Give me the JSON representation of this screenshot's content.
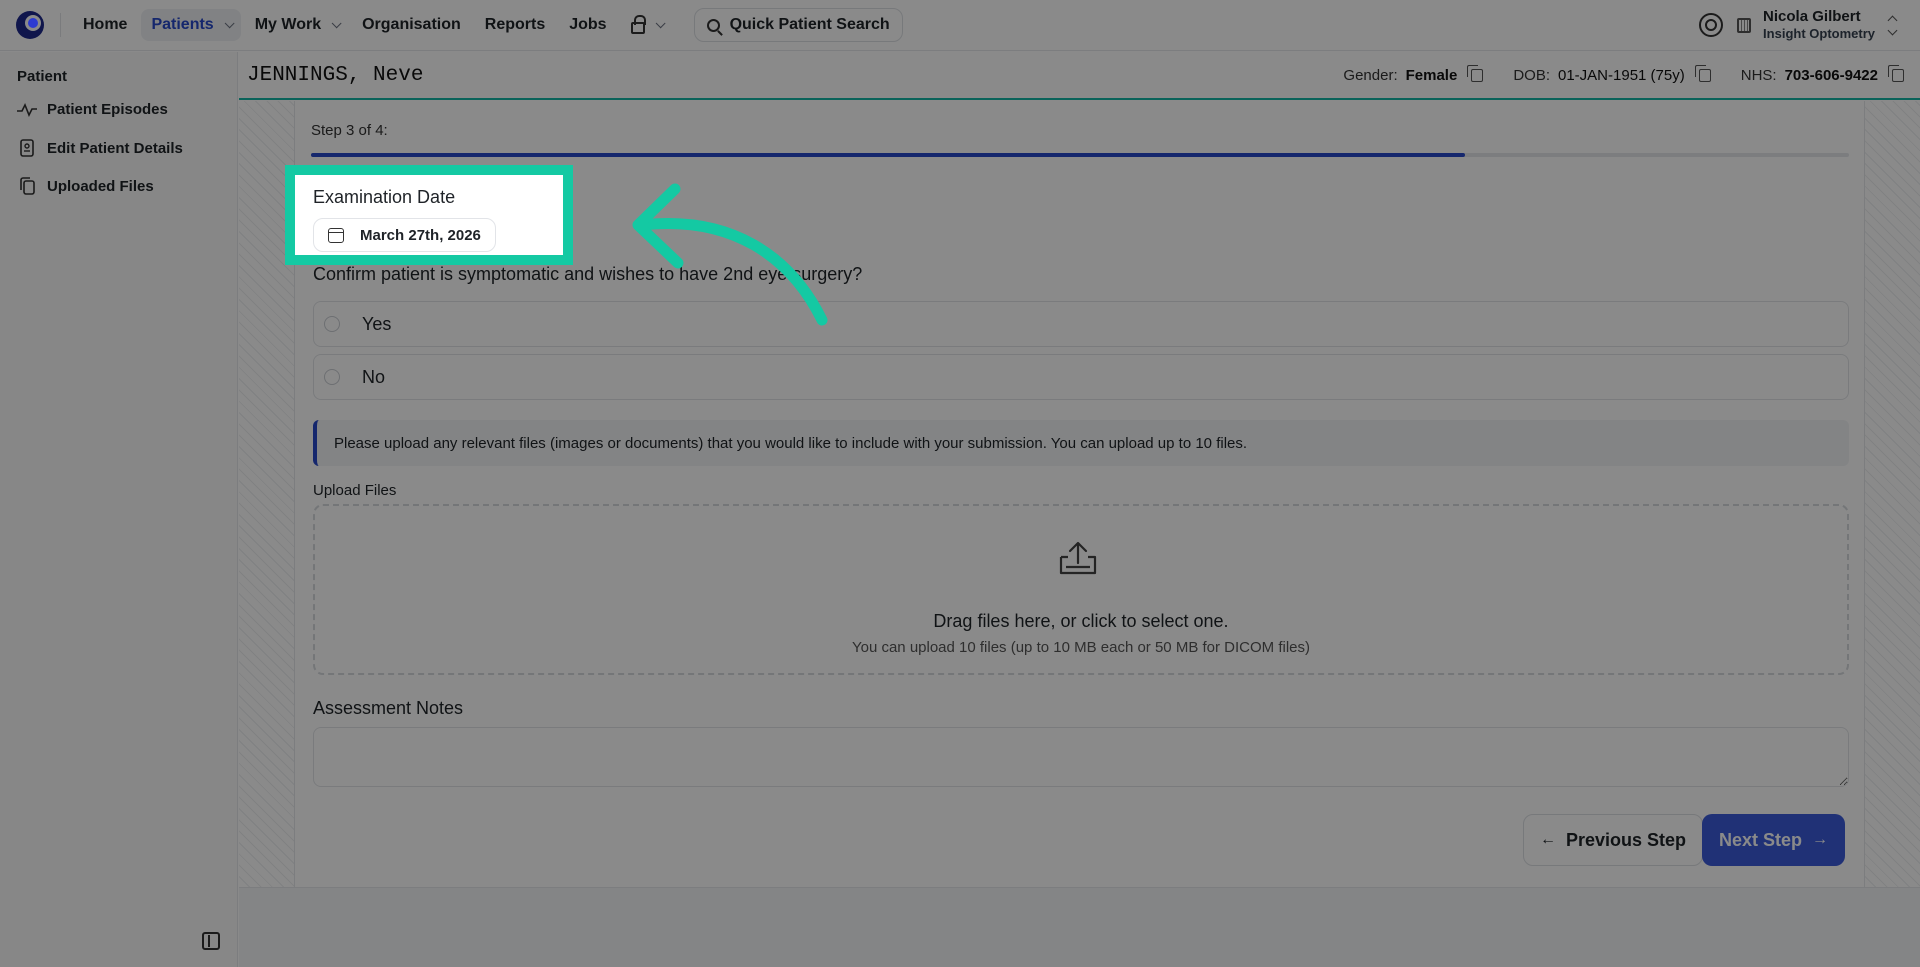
{
  "nav": {
    "items": [
      {
        "label": "Home"
      },
      {
        "label": "Patients"
      },
      {
        "label": "My Work"
      },
      {
        "label": "Organisation"
      },
      {
        "label": "Reports"
      },
      {
        "label": "Jobs"
      }
    ],
    "search_label": "Quick Patient Search",
    "user_name": "Nicola Gilbert",
    "user_org": "Insight Optometry"
  },
  "sidebar": {
    "heading": "Patient",
    "items": [
      {
        "label": "Patient Episodes",
        "icon": "pulse-icon"
      },
      {
        "label": "Edit Patient Details",
        "icon": "id-badge-icon"
      },
      {
        "label": "Uploaded Files",
        "icon": "files-icon"
      }
    ]
  },
  "patient": {
    "name": "JENNINGS, Neve",
    "gender_label": "Gender:",
    "gender": "Female",
    "dob_label": "DOB:",
    "dob": "01-JAN-1951 (75y)",
    "nhs_label": "NHS:",
    "nhs": "703-606-9422"
  },
  "form": {
    "step_label": "Step 3 of 4:",
    "step_current": 3,
    "step_total": 4,
    "progress_fraction": 0.75,
    "exam_date_label": "Examination Date",
    "exam_date": "March 27th, 2026",
    "question": "Confirm patient is symptomatic and wishes to have 2nd eye surgery?",
    "options": [
      {
        "label": "Yes"
      },
      {
        "label": "No"
      }
    ],
    "notice": "Please upload any relevant files (images or documents) that you would like to include with your submission. You can upload up to 10 files.",
    "upload_label": "Upload Files",
    "drop_main": "Drag files here, or click to select one.",
    "drop_sub": "You can upload 10 files (up to 10 MB each or 50 MB for DICOM files)",
    "notes_label": "Assessment Notes",
    "notes_value": "",
    "prev_label": "Previous Step",
    "next_label": "Next Step"
  },
  "colors": {
    "accent": "#2849c9",
    "highlight": "#14c9a3",
    "primary_button": "#3b5bdb"
  }
}
